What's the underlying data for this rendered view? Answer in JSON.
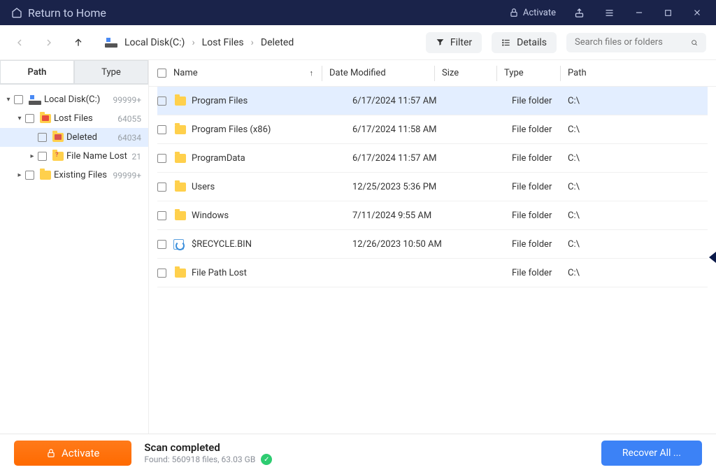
{
  "titlebar": {
    "return_label": "Return to Home",
    "activate_label": "Activate"
  },
  "toolbar": {
    "breadcrumb": [
      "Local Disk(C:)",
      "Lost Files",
      "Deleted"
    ],
    "filter_label": "Filter",
    "details_label": "Details",
    "search_placeholder": "Search files or folders"
  },
  "sidebar": {
    "tab_path": "Path",
    "tab_type": "Type",
    "tree": [
      {
        "label": "Local Disk(C:)",
        "count": "99999+",
        "level": 1,
        "expanded": true,
        "icon": "drive"
      },
      {
        "label": "Lost Files",
        "count": "64055",
        "level": 2,
        "expanded": true,
        "icon": "folder-red"
      },
      {
        "label": "Deleted",
        "count": "64034",
        "level": 3,
        "selected": true,
        "icon": "folder-del"
      },
      {
        "label": "File Name Lost",
        "count": "21",
        "level": 3,
        "caret": true,
        "icon": "folder-q"
      },
      {
        "label": "Existing Files",
        "count": "99999+",
        "level": 2,
        "caret": true,
        "icon": "folder"
      }
    ]
  },
  "columns": {
    "name": "Name",
    "date": "Date Modified",
    "size": "Size",
    "type": "Type",
    "path": "Path"
  },
  "files": [
    {
      "name": "Program Files",
      "date": "6/17/2024 11:57 AM",
      "size": "",
      "type": "File folder",
      "path": "C:\\",
      "icon": "folder",
      "selected": true
    },
    {
      "name": "Program Files (x86)",
      "date": "6/17/2024 11:58 AM",
      "size": "",
      "type": "File folder",
      "path": "C:\\",
      "icon": "folder"
    },
    {
      "name": "ProgramData",
      "date": "6/17/2024 11:57 AM",
      "size": "",
      "type": "File folder",
      "path": "C:\\",
      "icon": "folder"
    },
    {
      "name": "Users",
      "date": "12/25/2023 5:36 PM",
      "size": "",
      "type": "File folder",
      "path": "C:\\",
      "icon": "folder"
    },
    {
      "name": "Windows",
      "date": "7/11/2024 9:55 AM",
      "size": "",
      "type": "File folder",
      "path": "C:\\",
      "icon": "folder"
    },
    {
      "name": "$RECYCLE.BIN",
      "date": "12/26/2023 10:50 AM",
      "size": "",
      "type": "File folder",
      "path": "C:\\",
      "icon": "recycle"
    },
    {
      "name": "File Path Lost",
      "date": "",
      "size": "",
      "type": "File folder",
      "path": "C:\\",
      "icon": "folder"
    }
  ],
  "status": {
    "title": "Scan completed",
    "sub": "Found: 560918 files, 63.03 GB",
    "activate": "Activate",
    "recover": "Recover All ..."
  }
}
